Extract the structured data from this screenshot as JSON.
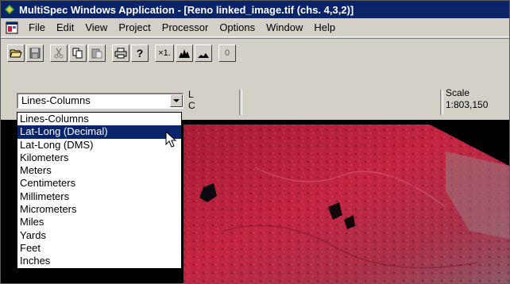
{
  "window": {
    "title": "MultiSpec Windows Application - [Reno linked_image.tif (chs. 4,3,2)]"
  },
  "menu": [
    "File",
    "Edit",
    "View",
    "Project",
    "Processor",
    "Options",
    "Window",
    "Help"
  ],
  "toolbar": {
    "buttons": [
      "open-icon",
      "save-icon",
      "cut-icon",
      "copy-icon",
      "paste-icon",
      "print-icon",
      "help-icon"
    ],
    "zoom_label": "×1.",
    "histogram_icons": [
      "histogram-icon",
      "histogram-small-icon"
    ],
    "overlay_label": "0"
  },
  "coords": {
    "selected": "Lines-Columns",
    "line_label": "L",
    "column_label": "C",
    "scale_label": "Scale",
    "scale_value": "1:803,150"
  },
  "dropdown": {
    "options": [
      "Lines-Columns",
      "Lat-Long (Decimal)",
      "Lat-Long (DMS)",
      "Kilometers",
      "Meters",
      "Centimeters",
      "Millimeters",
      "Micrometers",
      "Miles",
      "Yards",
      "Feet",
      "Inches"
    ],
    "highlighted_index": 1
  },
  "colors": {
    "titlebar": "#0a246a",
    "face": "#d4d0c8",
    "image_red": "#b0203a"
  }
}
